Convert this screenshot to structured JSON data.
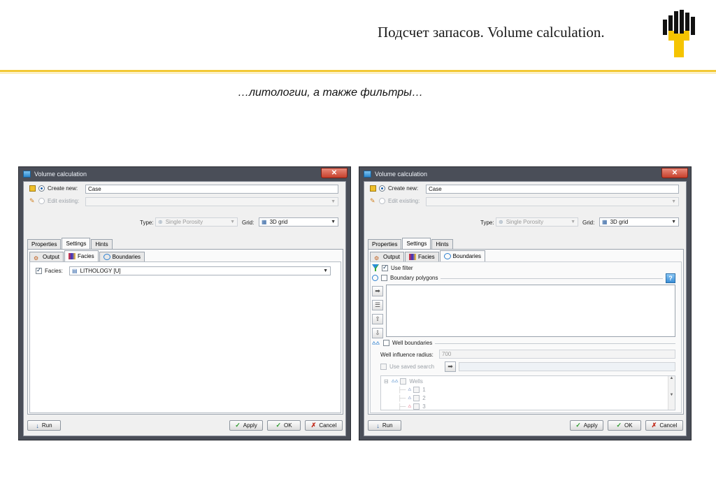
{
  "slide": {
    "title": "Подсчет запасов. Volume calculation.",
    "subtitle": "…литологии, а также фильтры…"
  },
  "colors": {
    "accent_rule": "#f2c833",
    "logo_yellow": "#f5c400",
    "logo_black": "#111111",
    "window_frame": "#4a4e58",
    "close_button": "#c6402c"
  },
  "window": {
    "title": "Volume calculation",
    "close_symbol": "✕",
    "create_new_label": "Create new:",
    "create_new_value": "Case",
    "edit_existing_label": "Edit existing:",
    "type_label": "Type:",
    "type_value": "Single Porosity",
    "grid_label": "Grid:",
    "grid_value": "3D grid",
    "main_tabs": [
      "Properties",
      "Settings",
      "Hints"
    ],
    "sub_tabs": [
      "Output",
      "Facies",
      "Boundaries"
    ],
    "buttons": {
      "run": "Run",
      "apply": "Apply",
      "ok": "OK",
      "cancel": "Cancel"
    }
  },
  "left": {
    "active_sub_tab": "Facies",
    "facies_label": "Facies:",
    "facies_value": "LITHOLOGY [U]"
  },
  "right": {
    "active_sub_tab": "Boundaries",
    "use_filter": "Use filter",
    "boundary_polygons": "Boundary polygons",
    "help_symbol": "?",
    "well_boundaries": "Well boundaries",
    "well_influence_label": "Well influence radius:",
    "well_influence_value": "700",
    "use_saved_search": "Use saved search",
    "tree_root": "Wells",
    "tree_items": [
      "1",
      "2",
      "3"
    ]
  }
}
